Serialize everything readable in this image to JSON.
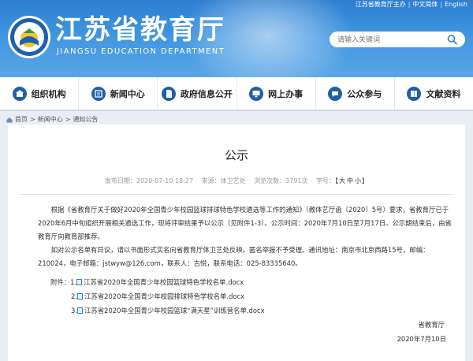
{
  "top_links": {
    "home": "江苏省教育厅主办",
    "lang_cn": "中文简体",
    "lang_en": "English"
  },
  "site": {
    "title_cn": "江苏省教育厅",
    "title_en": "JIANGSU EDUCATION DEPARTMENT"
  },
  "search": {
    "placeholder": "请输入关键词"
  },
  "nav": {
    "items": [
      {
        "label": "组织机构"
      },
      {
        "label": "新闻中心"
      },
      {
        "label": "政府信息公开"
      },
      {
        "label": "网上办事"
      },
      {
        "label": "公众参与"
      },
      {
        "label": "文献资料"
      }
    ]
  },
  "breadcrumb": {
    "home": "首页",
    "news": "新闻中心",
    "notice": "通知公告",
    "sep": ">"
  },
  "article": {
    "title": "公示",
    "date": "发布日期：2020-07-10 18:27",
    "source": "来源：体卫艺处",
    "views": "浏览次数：3791次",
    "font_label": "字号：",
    "font_large": "大",
    "font_mid": "中",
    "font_small": "小",
    "para1": "根据《省教育厅关于做好2020年全国青少年校园篮球排球特色学校遴选等工作的通知》（教体艺厅函〔2020〕5号）要求，省教育厅已于2020年6月中旬组织开展相关遴选工作，现将评审结果予以公示（见附件1-3）。公示时间：2020年7月10日至7月17日。公示期结束后，由省教育厅向教育部推荐。",
    "para2": "如对公示名单有异议，请以书面形式实名向省教育厅体卫艺处反映。匿名举报不予受理。通讯地址：南京市北京西路15号，邮编：210024，电子邮箱：jstwyw@126.com，联系人：古悦，联系电话：025-83335640。",
    "attach_label": "附件：",
    "attachments": [
      {
        "num": "1.",
        "name": "江苏省2020年全国青少年校园篮球特色学校名单.docx"
      },
      {
        "num": "2.",
        "name": "江苏省2020年全国青少年校园排球特色学校名单.docx"
      },
      {
        "num": "3.",
        "name": "江苏省2020年全国青少年校园篮球“满天星”训练营名单.docx"
      }
    ],
    "signer": "省教育厅",
    "sign_date": "2020年7月10日"
  },
  "colors": {
    "header_blue": "#2d7ed0",
    "nav_icon": "#1f5fa8"
  }
}
